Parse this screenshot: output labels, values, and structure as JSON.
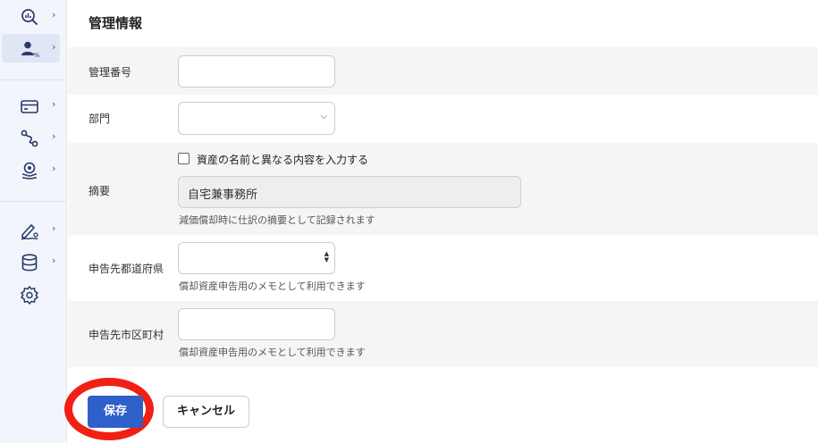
{
  "sidebar": {
    "items": [
      {
        "name": "analytics-search-icon",
        "chevron": "›"
      },
      {
        "name": "user-percent-icon",
        "chevron": "›"
      },
      {
        "name": "credit-card-icon",
        "chevron": "›"
      },
      {
        "name": "route-icon",
        "chevron": "›"
      },
      {
        "name": "asset-gear-icon",
        "chevron": "›"
      },
      {
        "name": "signature-icon",
        "chevron": "›"
      },
      {
        "name": "database-icon",
        "chevron": "›"
      },
      {
        "name": "settings-gear-icon",
        "chevron": ""
      }
    ],
    "accent": "#2f5fc8"
  },
  "form": {
    "section_title": "管理情報",
    "management_number": {
      "label": "管理番号",
      "value": ""
    },
    "department": {
      "label": "部門",
      "value": ""
    },
    "summary": {
      "label": "摘要",
      "checkbox_label": "資産の名前と異なる内容を入力する",
      "checked": false,
      "value": "自宅兼事務所",
      "hint": "減価償却時に仕訳の摘要として記録されます"
    },
    "prefecture": {
      "label": "申告先都道府県",
      "value": "",
      "hint": "償却資産申告用のメモとして利用できます"
    },
    "municipality": {
      "label": "申告先市区町村",
      "value": "",
      "hint": "償却資産申告用のメモとして利用できます"
    }
  },
  "buttons": {
    "save": "保存",
    "cancel": "キャンセル"
  },
  "colors": {
    "highlight": "#f21f14",
    "primary": "#2f5fc8"
  }
}
